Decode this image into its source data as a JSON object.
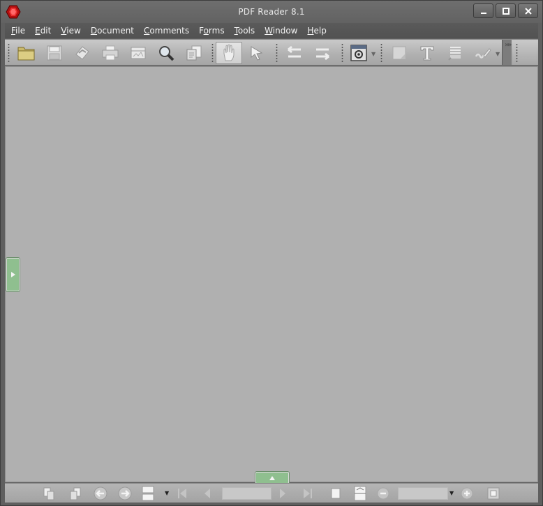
{
  "window": {
    "title": "PDF Reader 8.1",
    "controls": [
      "minimize",
      "maximize",
      "close"
    ]
  },
  "menu": [
    {
      "label": "File",
      "accel": "F",
      "rest": "ile"
    },
    {
      "label": "Edit",
      "accel": "E",
      "rest": "dit"
    },
    {
      "label": "View",
      "accel": "V",
      "rest": "iew"
    },
    {
      "label": "Document",
      "accel": "D",
      "rest": "ocument"
    },
    {
      "label": "Comments",
      "accel": "C",
      "rest": "omments"
    },
    {
      "label": "Forms",
      "accel": "o",
      "pre": "F",
      "rest": "rms"
    },
    {
      "label": "Tools",
      "accel": "T",
      "rest": "ools"
    },
    {
      "label": "Window",
      "accel": "W",
      "rest": "indow"
    },
    {
      "label": "Help",
      "accel": "H",
      "rest": "elp"
    }
  ],
  "toolbar": {
    "tools": [
      "open-folder-icon",
      "save-icon",
      "email-icon",
      "print-icon",
      "scan-icon",
      "search-icon",
      "copy-pages-icon",
      "hand-tool-icon",
      "select-arrow-icon",
      "previous-view-icon",
      "next-view-icon",
      "settings-icon",
      "note-icon",
      "text-icon",
      "highlight-text-icon",
      "signature-icon"
    ],
    "active_tool": "hand-tool-icon"
  },
  "statusbar": {
    "page_value": "",
    "zoom_value": ""
  },
  "colors": {
    "titlebar": "#666666",
    "menubar": "#555555",
    "workspace": "#b0b0b0",
    "panel_tab": "#8fbf8f",
    "app_icon": "#d11a1a"
  }
}
